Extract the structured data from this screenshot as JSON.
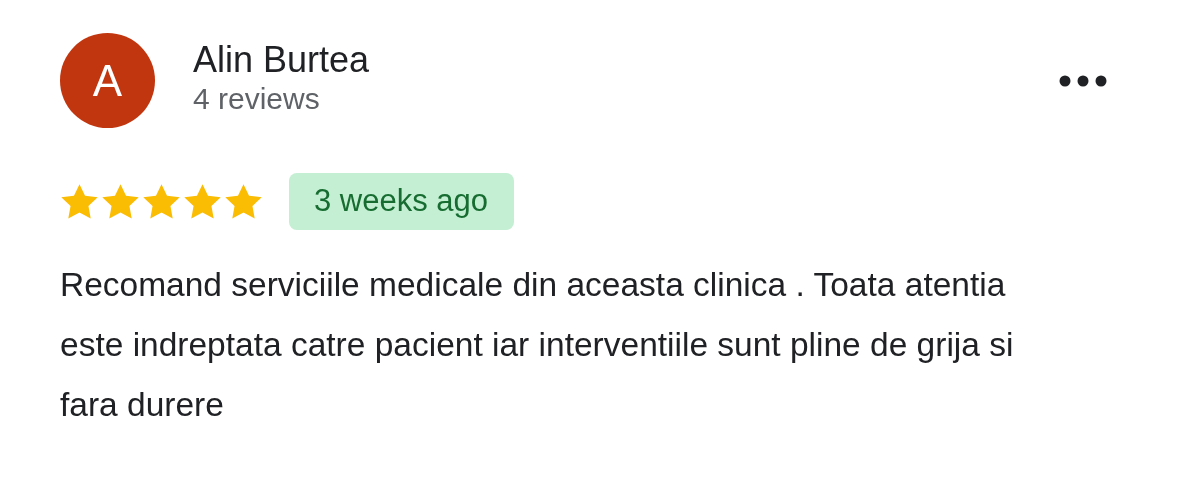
{
  "review": {
    "avatar_letter": "A",
    "author": "Alin Burtea",
    "review_count": "4 reviews",
    "stars": 5,
    "date": "3 weeks ago",
    "text": "Recomand serviciile medicale din aceasta clinica . Toata atentia este indreptata catre pacient iar interventiile sunt pline de grija si fara durere"
  }
}
